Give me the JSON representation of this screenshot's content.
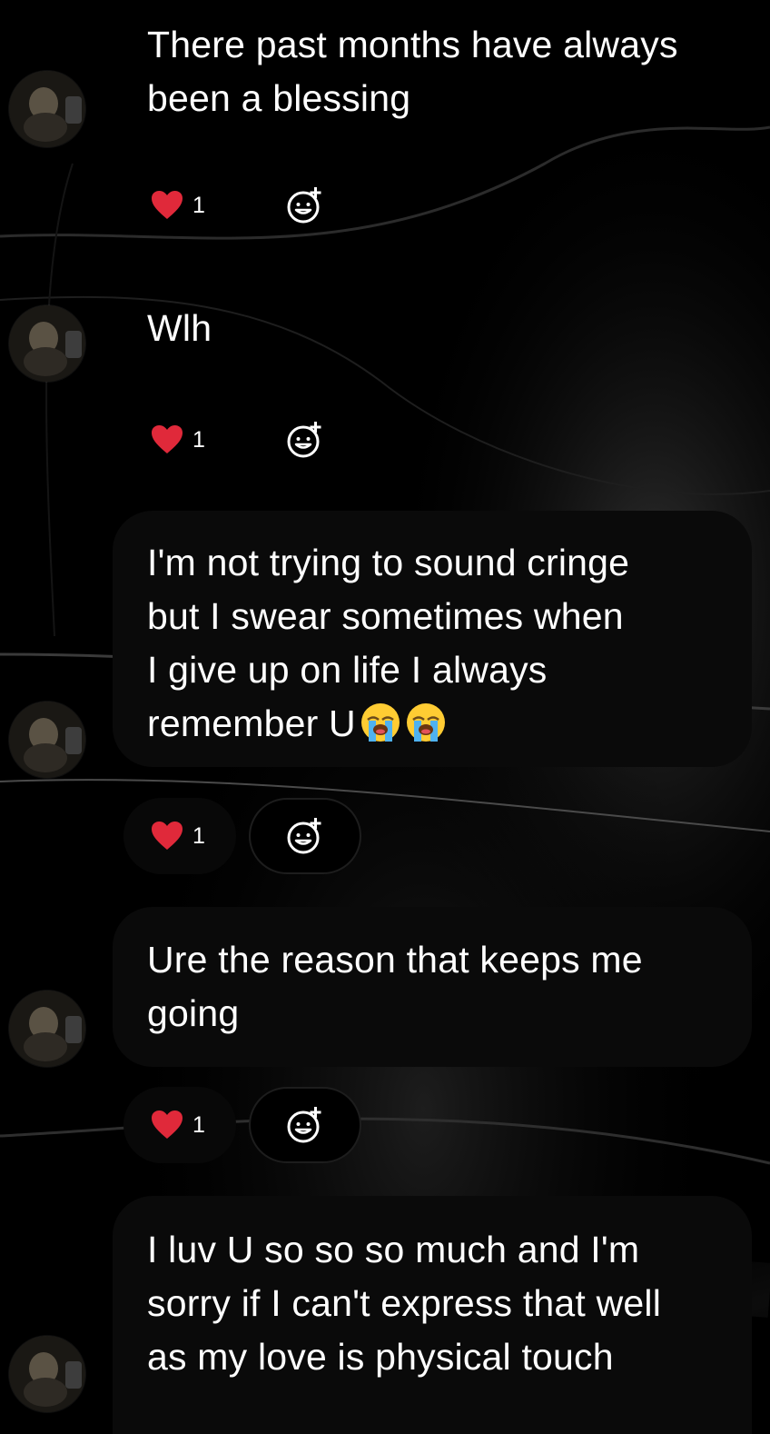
{
  "messages": [
    {
      "text": "There past months have always\nbeen a blessing",
      "reaction": {
        "icon": "heart-icon",
        "count": "1"
      },
      "emojis": []
    },
    {
      "text": "Wlh",
      "reaction": {
        "icon": "heart-icon",
        "count": "1"
      },
      "emojis": []
    },
    {
      "text": "I'm not trying to sound cringe\nbut I swear sometimes when\nI give up on life I always\nremember U",
      "reaction": {
        "icon": "heart-icon",
        "count": "1"
      },
      "emojis": [
        "loudly-crying-face-icon",
        "loudly-crying-face-icon"
      ]
    },
    {
      "text": "Ure the reason that keeps me\ngoing",
      "reaction": {
        "icon": "heart-icon",
        "count": "1"
      },
      "emojis": []
    },
    {
      "text": "I luv U so so so much and I'm\nsorry if I can't express that well\nas my love is physical touch",
      "emojis": []
    }
  ],
  "colors": {
    "background": "#000000",
    "bubble": "#0a0a0a",
    "text": "#ffffff",
    "heart": "#e0293a",
    "add_reaction_icon": "#ffffff"
  }
}
